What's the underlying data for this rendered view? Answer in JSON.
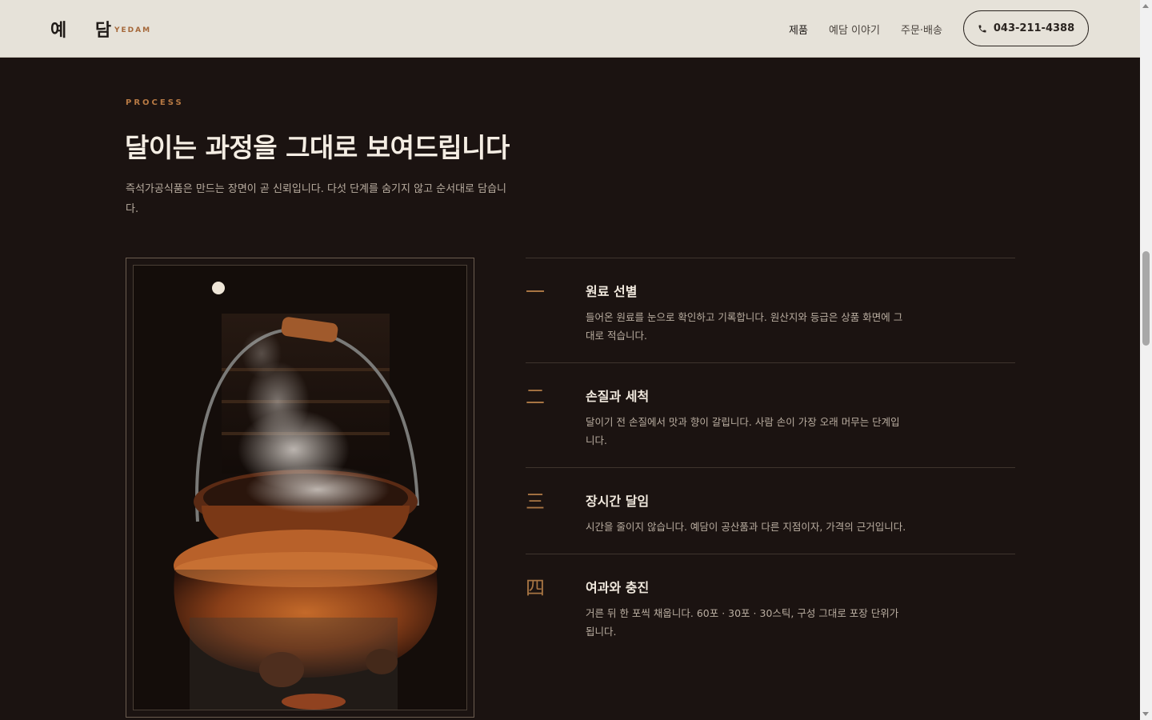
{
  "header": {
    "logo": "예 담",
    "logo_sub": "YEDAM",
    "nav": [
      {
        "label": "제품"
      },
      {
        "label": "예담 이야기"
      },
      {
        "label": "주문·배송"
      }
    ],
    "phone": "043-211-4388"
  },
  "section": {
    "eyebrow": "PROCESS",
    "title": "달이는 과정을 그대로 보여드립니다",
    "description": "즉석가공식품은 만드는 장면이 곧 신뢰입니다. 다섯 단계를 숨기지 않고 순서대로 담습니다."
  },
  "steps": [
    {
      "num": "一",
      "title": "원료 선별",
      "text": "들어온 원료를 눈으로 확인하고 기록합니다. 원산지와 등급은 상품 화면에 그대로 적습니다."
    },
    {
      "num": "二",
      "title": "손질과 세척",
      "text": "달이기 전 손질에서 맛과 향이 갈립니다. 사람 손이 가장 오래 머무는 단계입니다."
    },
    {
      "num": "三",
      "title": "장시간 달임",
      "text": "시간을 줄이지 않습니다. 예담이 공산품과 다른 지점이자, 가격의 근거입니다."
    },
    {
      "num": "四",
      "title": "여과와 충진",
      "text": "거른 뒤 한 포씩 채웁니다. 60포 · 30포 · 30스틱, 구성 그대로 포장 단위가 됩니다."
    }
  ],
  "colors": {
    "background": "#1b1311",
    "header_bg": "#e6e2d9",
    "accent": "#b87a44"
  },
  "icons": {
    "phone": "phone-icon"
  }
}
